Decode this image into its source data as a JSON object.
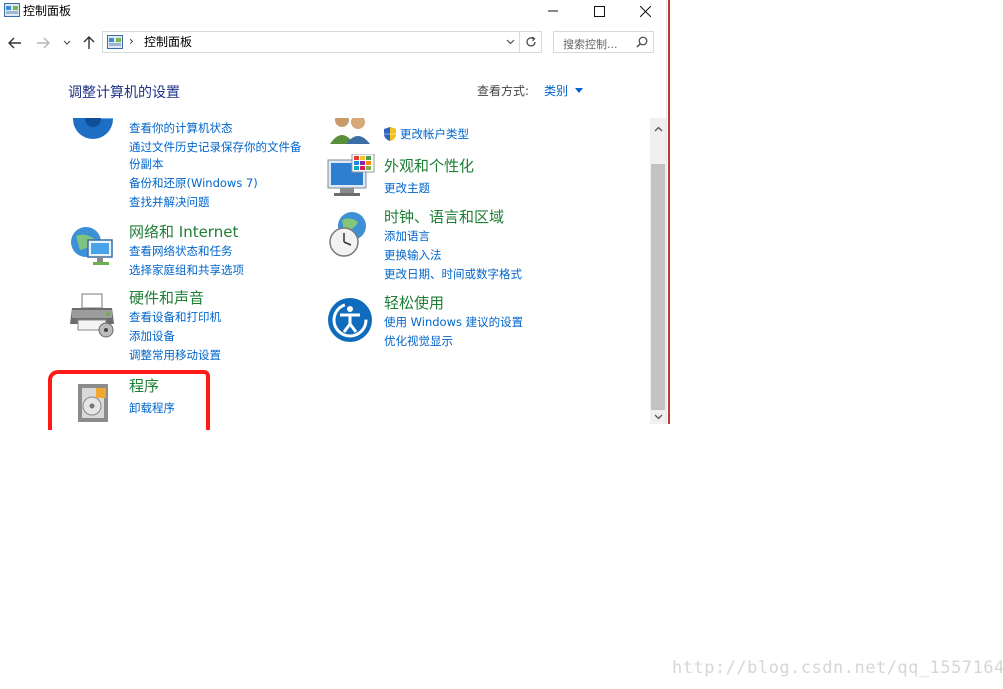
{
  "window": {
    "title": "控制面板"
  },
  "address_bar": {
    "path": "控制面板",
    "separator": "›",
    "search_placeholder": "搜索控制..."
  },
  "page": {
    "heading": "调整计算机的设置",
    "view_by_label": "查看方式:",
    "view_by_value": "类别"
  },
  "categories": {
    "system": {
      "icon": "system-security-icon",
      "links": [
        "查看你的计算机状态",
        "通过文件历史记录保存你的文件备",
        "份副本",
        "备份和还原(Windows 7)",
        "查找并解决问题"
      ]
    },
    "network": {
      "icon": "network-icon",
      "title": "网络和 Internet",
      "links": [
        "查看网络状态和任务",
        "选择家庭组和共享选项"
      ]
    },
    "hardware": {
      "icon": "printer-icon",
      "title": "硬件和声音",
      "links": [
        "查看设备和打印机",
        "添加设备",
        "调整常用移动设置"
      ]
    },
    "programs": {
      "icon": "programs-icon",
      "title": "程序",
      "links": [
        "卸载程序"
      ]
    },
    "accounts": {
      "icon": "user-accounts-icon",
      "links": [
        "更改帐户类型"
      ]
    },
    "appearance": {
      "icon": "appearance-icon",
      "title": "外观和个性化",
      "links": [
        "更改主题"
      ]
    },
    "clock": {
      "icon": "clock-globe-icon",
      "title": "时钟、语言和区域",
      "links": [
        "添加语言",
        "更换输入法",
        "更改日期、时间或数字格式"
      ]
    },
    "ease": {
      "icon": "ease-of-access-icon",
      "title": "轻松使用",
      "links": [
        "使用 Windows 建议的设置",
        "优化视觉显示"
      ]
    }
  },
  "watermark": "http://blog.csdn.net/qq_15571649",
  "colors": {
    "link": "#0066cc",
    "category_title": "#1e7e34",
    "heading": "#1e3287",
    "highlight": "#ff1a1a"
  }
}
